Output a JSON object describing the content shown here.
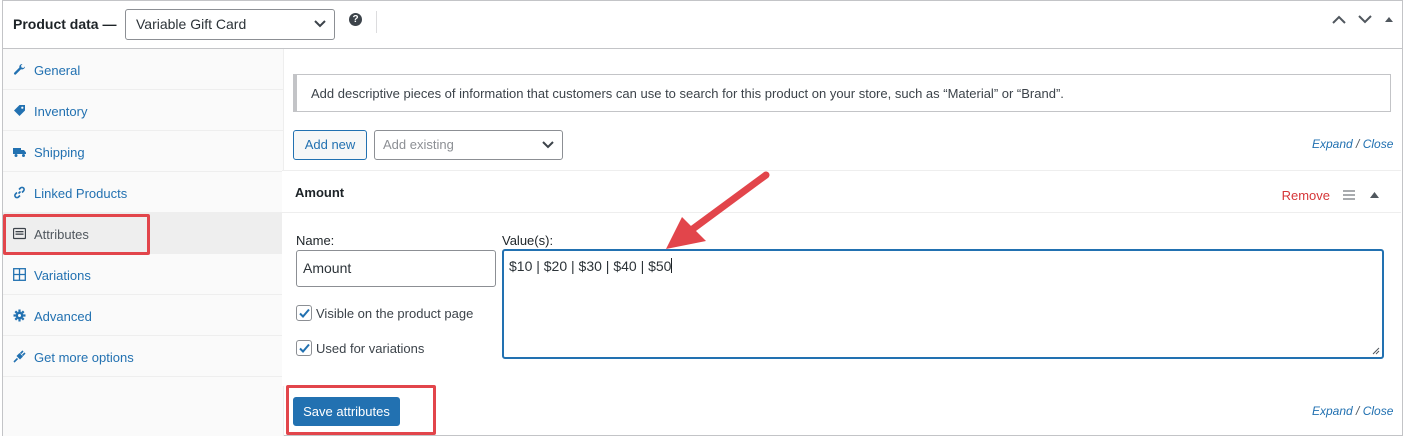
{
  "header": {
    "label": "Product data —",
    "product_type": "Variable Gift Card",
    "help_glyph": "?"
  },
  "sidebar": {
    "items": [
      {
        "label": "General",
        "icon": "wrench-icon"
      },
      {
        "label": "Inventory",
        "icon": "tag-icon"
      },
      {
        "label": "Shipping",
        "icon": "truck-icon"
      },
      {
        "label": "Linked Products",
        "icon": "link-icon"
      },
      {
        "label": "Attributes",
        "icon": "list-icon",
        "active": true
      },
      {
        "label": "Variations",
        "icon": "grid-icon"
      },
      {
        "label": "Advanced",
        "icon": "gear-icon"
      },
      {
        "label": "Get more options",
        "icon": "plugin-icon"
      }
    ]
  },
  "main": {
    "notice": "Add descriptive pieces of information that customers can use to search for this product on your store, such as “Material” or “Brand”.",
    "add_new_label": "Add new",
    "add_existing_placeholder": "Add existing",
    "expand_label": "Expand",
    "close_label": "Close",
    "slash": " / ",
    "attribute": {
      "title": "Amount",
      "remove_label": "Remove",
      "name_label": "Name:",
      "name_value": "Amount",
      "values_label": "Value(s):",
      "values_value": "$10 | $20 | $30 | $40 | $50",
      "visible_label": "Visible on the product page",
      "visible_checked": true,
      "variations_label": "Used for variations",
      "variations_checked": true
    },
    "save_label": "Save attributes"
  },
  "colors": {
    "accent": "#2271b1",
    "danger": "#d63638",
    "annotation": "#e2454b"
  }
}
